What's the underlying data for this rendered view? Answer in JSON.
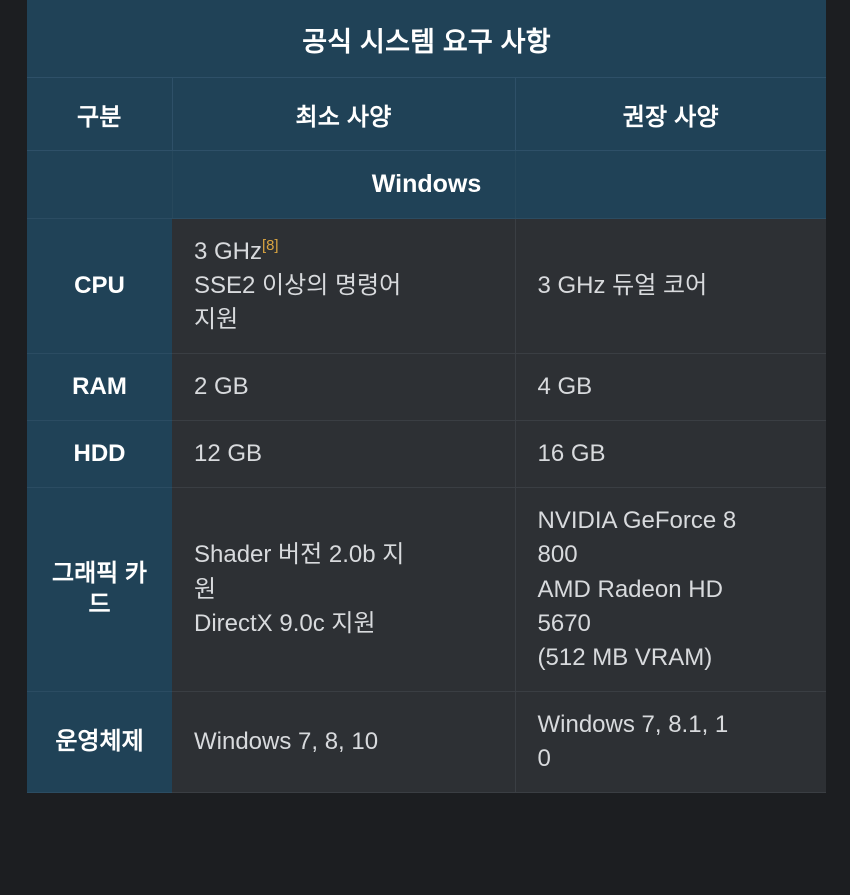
{
  "table": {
    "title": "공식 시스템 요구 사항",
    "columns": [
      "구분",
      "최소 사양",
      "권장 사양"
    ],
    "sections": [
      {
        "name": "Windows",
        "rows": [
          {
            "label": "CPU",
            "min_lines": [
              "3 GHz",
              "SSE2 이상의 명령어",
              "지원"
            ],
            "min_ref": "[8]",
            "rec_lines": [
              "3 GHz 듀얼 코어"
            ]
          },
          {
            "label": "RAM",
            "min_lines": [
              "2 GB"
            ],
            "rec_lines": [
              "4 GB"
            ]
          },
          {
            "label": "HDD",
            "min_lines": [
              "12 GB"
            ],
            "rec_lines": [
              "16 GB"
            ]
          },
          {
            "label": "그래픽 카드",
            "min_lines": [
              "Shader 버전 2.0b 지",
              "원",
              "DirectX 9.0c 지원"
            ],
            "rec_lines": [
              "NVIDIA GeForce 8",
              "800",
              "AMD Radeon HD",
              "5670",
              "(512 MB VRAM)"
            ]
          },
          {
            "label": "운영체제",
            "min_lines": [
              "Windows 7, 8, 10"
            ],
            "rec_lines": [
              "Windows 7, 8.1, 1",
              "0"
            ]
          }
        ]
      }
    ]
  },
  "colors": {
    "page_background": "#1c1e21",
    "header_background": "#204257",
    "cell_background": "#2d3034",
    "header_text": "#ffffff",
    "body_text": "#d8dadd",
    "reference_link": "#d9a441",
    "grid_line": "#3a3e43"
  }
}
